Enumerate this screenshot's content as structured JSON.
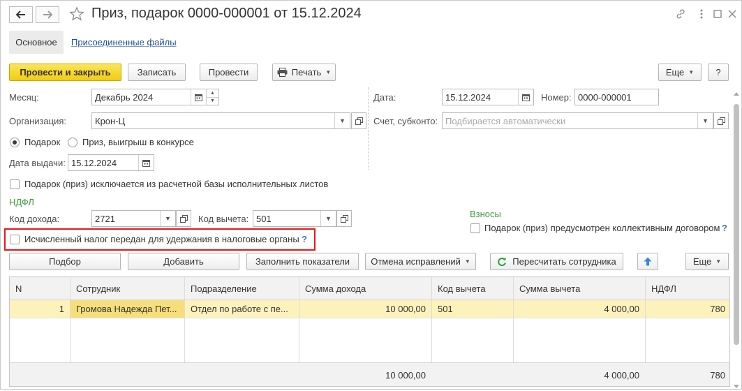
{
  "header": {
    "title": "Приз, подарок 0000-000001 от 15.12.2024"
  },
  "tabs": {
    "main": "Основное",
    "files": "Присоединенные файлы"
  },
  "toolbar": {
    "post_close": "Провести и закрыть",
    "save": "Записать",
    "post": "Провести",
    "print": "Печать",
    "more": "Еще",
    "help": "?"
  },
  "form": {
    "month_label": "Месяц:",
    "month_value": "Декабрь 2024",
    "org_label": "Организация:",
    "org_value": "Крон-Ц",
    "radio_gift": "Подарок",
    "radio_prize": "Приз, выигрыш в конкурсе",
    "issue_label": "Дата выдачи:",
    "issue_value": "15.12.2024",
    "excluded_label": "Подарок (приз) исключается из расчетной базы исполнительных листов",
    "ndfl_title": "НДФЛ",
    "income_code_label": "Код дохода:",
    "income_code_value": "2721",
    "deduction_label": "Код вычета:",
    "deduction_value": "501",
    "tax_transferred_label": "Исчисленный налог передан для удержания в налоговые органы",
    "q": "?",
    "date_label": "Дата:",
    "date_value": "15.12.2024",
    "number_label": "Номер:",
    "number_value": "0000-000001",
    "account_label": "Счет, субконто:",
    "account_placeholder": "Подбирается автоматически",
    "contrib_title": "Взносы",
    "collective_label": "Подарок (приз) предусмотрен коллективным договором"
  },
  "table_toolbar": {
    "select": "Подбор",
    "add": "Добавить",
    "fill": "Заполнить показатели",
    "cancel_fix": "Отмена исправлений",
    "recalc": "Пересчитать сотрудника",
    "more": "Еще"
  },
  "table": {
    "columns": [
      "N",
      "Сотрудник",
      "Подразделение",
      "Сумма дохода",
      "Код вычета",
      "Сумма вычета",
      "НДФЛ"
    ],
    "rows": [
      [
        "1",
        "Громова Надежда Пет...",
        "Отдел по работе с пе...",
        "10 000,00",
        "501",
        "4 000,00",
        "780"
      ]
    ],
    "totals": {
      "income": "10 000,00",
      "deduction": "4 000,00",
      "ndfl": "780"
    }
  },
  "colors": {
    "primary_button": "#f1cc0e",
    "highlight_box": "#e01b1b",
    "selected_row": "#fdf2bc",
    "section_title": "#3d9a3d",
    "link": "#1d4f91"
  },
  "icons": [
    "back-arrow-icon",
    "forward-arrow-icon",
    "star-icon",
    "link-icon",
    "more-vert-icon",
    "maximize-icon",
    "close-icon",
    "printer-icon",
    "calendar-icon",
    "open-form-icon",
    "refresh-icon",
    "up-arrow-icon"
  ]
}
